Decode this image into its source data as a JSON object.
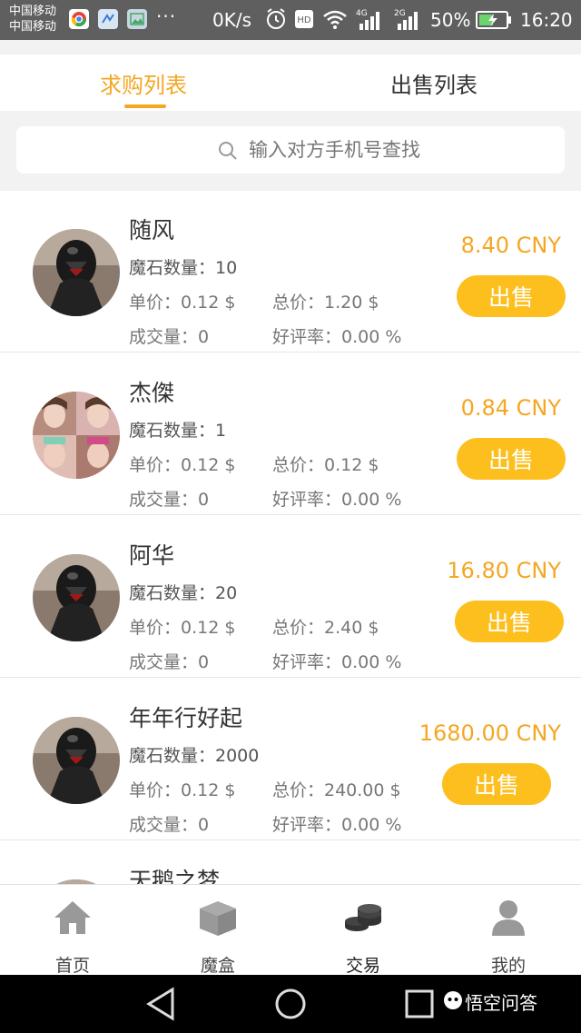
{
  "status_bar": {
    "carrier_1": "中国移动",
    "carrier_2": "中国移动",
    "dots": "···",
    "speed": "0K/s",
    "signal_1_label": "4G",
    "signal_2_label": "2G",
    "battery": "50%",
    "time": "16:20"
  },
  "tabs": {
    "buy": "求购列表",
    "sell": "出售列表",
    "active": "buy"
  },
  "search": {
    "placeholder": "输入对方手机号查找",
    "value": ""
  },
  "listings": [
    {
      "name": "随风",
      "quantity": "魔石数量：10",
      "unit_price": "单价：0.12 $",
      "total_price": "总价：1.20 $",
      "volume": "成交量：0",
      "rating": "好评率：0.00 %",
      "price": "8.40 CNY",
      "action": "出售",
      "avatar": "dark-armored-figure"
    },
    {
      "name": "杰傑",
      "quantity": "魔石数量：1",
      "unit_price": "单价：0.12 $",
      "total_price": "总价：0.12 $",
      "volume": "成交量：0",
      "rating": "好评率：0.00 %",
      "price": "0.84 CNY",
      "action": "出售",
      "avatar": "collage-photo"
    },
    {
      "name": "阿华",
      "quantity": "魔石数量：20",
      "unit_price": "单价：0.12 $",
      "total_price": "总价：2.40 $",
      "volume": "成交量：0",
      "rating": "好评率：0.00 %",
      "price": "16.80 CNY",
      "action": "出售",
      "avatar": "dark-armored-figure"
    },
    {
      "name": "年年行好起",
      "quantity": "魔石数量：2000",
      "unit_price": "单价：0.12 $",
      "total_price": "总价：240.00 $",
      "volume": "成交量：0",
      "rating": "好评率：0.00 %",
      "price": "1680.00 CNY",
      "action": "出售",
      "avatar": "dark-armored-figure"
    },
    {
      "name": "天鹅之梦",
      "avatar": "dark-armored-figure"
    }
  ],
  "bottom_nav": [
    {
      "label": "首页",
      "icon": "home-icon"
    },
    {
      "label": "魔盒",
      "icon": "box-icon"
    },
    {
      "label": "交易",
      "icon": "coins-icon",
      "active": true
    },
    {
      "label": "我的",
      "icon": "user-icon"
    }
  ],
  "watermark": "悟空问答",
  "colors": {
    "accent": "#f5a623",
    "button": "#fcbf1e",
    "status_bar": "#5f5f5f"
  }
}
